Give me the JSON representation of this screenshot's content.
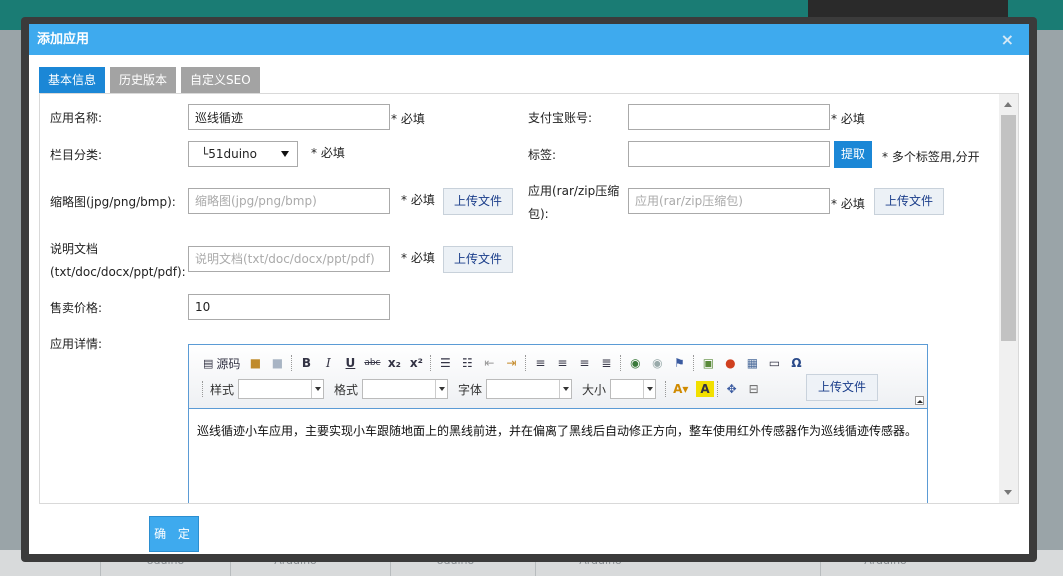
{
  "dialog": {
    "title": "添加应用",
    "close_label": "×"
  },
  "tabs": [
    {
      "label": "基本信息"
    },
    {
      "label": "历史版本"
    },
    {
      "label": "自定义SEO"
    }
  ],
  "form": {
    "app_name": {
      "label": "应用名称:",
      "value": "巡线循迹",
      "required": "* 必填"
    },
    "alipay": {
      "label": "支付宝账号:",
      "value": "",
      "required": "* 必填"
    },
    "category": {
      "label": "栏目分类:",
      "value": "└51duino",
      "required": "* 必填"
    },
    "tags": {
      "label": "标签:",
      "value": "",
      "button": "提取",
      "hint": "* 多个标签用,分开"
    },
    "thumbnail": {
      "label": "缩略图(jpg/png/bmp):",
      "placeholder": "缩略图(jpg/png/bmp)",
      "required": "* 必填",
      "button": "上传文件"
    },
    "app_file": {
      "label_line1": "应用(rar/zip压缩",
      "label_line2": "包):",
      "placeholder": "应用(rar/zip压缩包)",
      "required": "* 必填",
      "button": "上传文件"
    },
    "doc": {
      "label_line1": "说明文档",
      "label_line2": "(txt/doc/docx/ppt/pdf):",
      "placeholder": "说明文档(txt/doc/docx/ppt/pdf)",
      "required": "* 必填",
      "button": "上传文件"
    },
    "price": {
      "label": "售卖价格:",
      "value": "10"
    },
    "detail": {
      "label": "应用详情:"
    }
  },
  "editor": {
    "source_label": "源码",
    "style_label": "样式",
    "format_label": "格式",
    "font_label": "字体",
    "size_label": "大小",
    "upload_label": "上传文件",
    "content": "巡线循迹小车应用，主要实现小车跟随地面上的黑线前进，并在偏离了黑线后自动修正方向，整车使用红外传感器作为巡线循迹传感器。"
  },
  "footer": {
    "confirm_label": "确 定"
  },
  "background": {
    "bottom_items": [
      "oduino",
      "Arduino",
      "oduino",
      "Arduino",
      "Arduino"
    ]
  }
}
